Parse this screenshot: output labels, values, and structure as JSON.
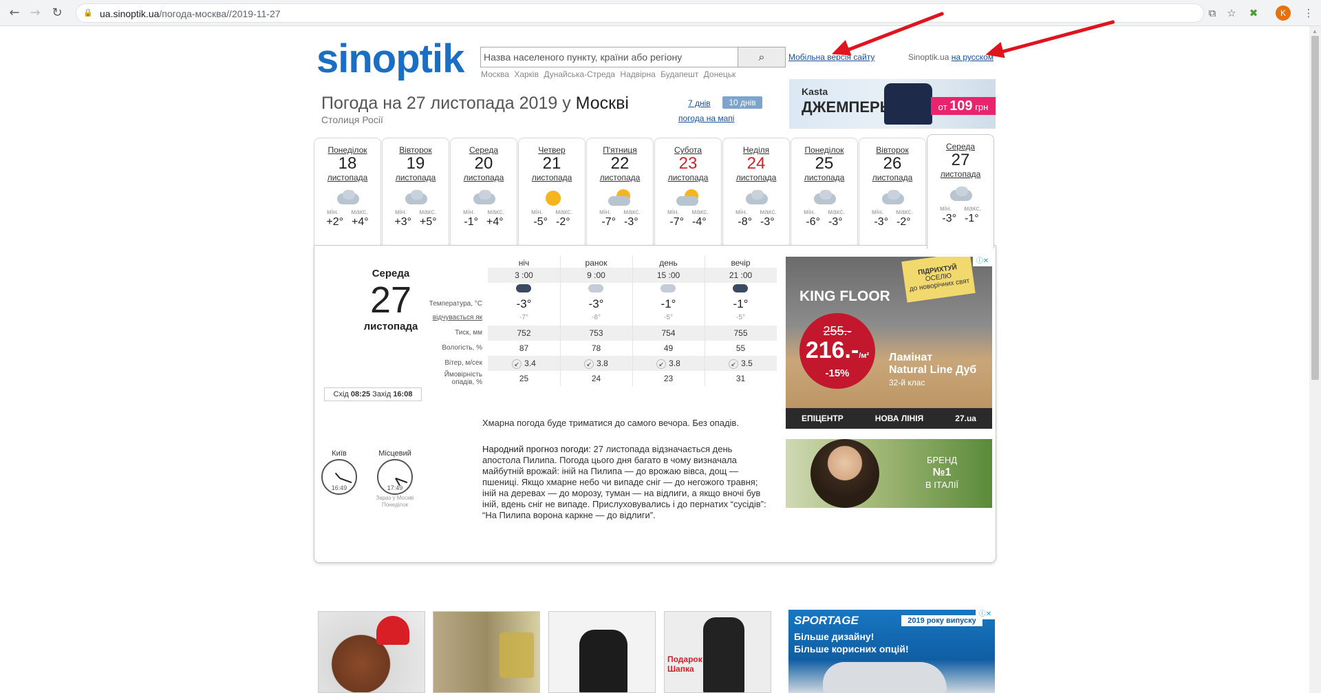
{
  "browser": {
    "url_host": "ua.sinoptik.ua",
    "url_path": "/погода-москва//2019-11-27",
    "profile_initial": "K"
  },
  "header": {
    "logo": "sinoptik",
    "search_placeholder": "Назва населеного пункту, країни або регіону",
    "quick_cities": [
      "Москва",
      "Харків",
      "Дунайська-Стреда",
      "Надвірна",
      "Будапешт",
      "Донецьк"
    ],
    "mobile_link": "Мобільна версія сайту",
    "ru_prefix": "Sinoptik.ua",
    "ru_link": "на русском"
  },
  "title": {
    "main": "Погода на 27 листопада 2019",
    "prep": "у",
    "city": "Москві",
    "subtitle": "Столиця Росії",
    "days7": "7 днів",
    "days10": "10 днів",
    "map": "погода на мапі"
  },
  "top_banner": {
    "brand": "Kasta",
    "product": "ДЖЕМПЕРЫ",
    "price_prefix": "от",
    "price": "109",
    "currency": "грн"
  },
  "days": [
    {
      "name": "Понеділок",
      "num": "18",
      "month": "листопада",
      "min": "+2°",
      "max": "+4°",
      "icon": "cloud-icon",
      "red": false
    },
    {
      "name": "Вівторок",
      "num": "19",
      "month": "листопада",
      "min": "+3°",
      "max": "+5°",
      "icon": "cloud-icon",
      "red": false
    },
    {
      "name": "Середа",
      "num": "20",
      "month": "листопада",
      "min": "-1°",
      "max": "+4°",
      "icon": "cloud-icon",
      "red": false
    },
    {
      "name": "Четвер",
      "num": "21",
      "month": "листопада",
      "min": "-5°",
      "max": "-2°",
      "icon": "sun-icon",
      "red": false
    },
    {
      "name": "П'ятниця",
      "num": "22",
      "month": "листопада",
      "min": "-7°",
      "max": "-3°",
      "icon": "sun-cloud-icon",
      "red": false
    },
    {
      "name": "Субота",
      "num": "23",
      "month": "листопада",
      "min": "-7°",
      "max": "-4°",
      "icon": "sun-cloud-icon",
      "red": true
    },
    {
      "name": "Неділя",
      "num": "24",
      "month": "листопада",
      "min": "-8°",
      "max": "-3°",
      "icon": "cloud-icon",
      "red": true
    },
    {
      "name": "Понеділок",
      "num": "25",
      "month": "листопада",
      "min": "-6°",
      "max": "-3°",
      "icon": "cloud-icon",
      "red": false
    },
    {
      "name": "Вівторок",
      "num": "26",
      "month": "листопада",
      "min": "-3°",
      "max": "-2°",
      "icon": "cloud-icon",
      "red": false
    },
    {
      "name": "Середа",
      "num": "27",
      "month": "листопада",
      "min": "-3°",
      "max": "-1°",
      "icon": "cloud-icon",
      "red": false
    }
  ],
  "labels": {
    "min": "мін.",
    "max": "макс."
  },
  "detail": {
    "day_name": "Середа",
    "day_num": "27",
    "month": "листопада",
    "sunrise_label": "Схід",
    "sunrise": "08:25",
    "sunset_label": "Захід",
    "sunset": "16:08",
    "periods": [
      "ніч",
      "ранок",
      "день",
      "вечір"
    ],
    "hours": [
      "3 :00",
      "9 :00",
      "15 :00",
      "21 :00"
    ],
    "row_labels": {
      "temp": "Температура, °C",
      "feels": "відчувається як",
      "pressure": "Тиск, мм",
      "humidity": "Вологість, %",
      "wind": "Вітер, м/сек",
      "precip_1": "Ймовірність",
      "precip_2": "опадів, %"
    },
    "temp": [
      "-3°",
      "-3°",
      "-1°",
      "-1°"
    ],
    "feels": [
      "-7°",
      "-8°",
      "-5°",
      "-5°"
    ],
    "pressure": [
      "752",
      "753",
      "754",
      "755"
    ],
    "humidity": [
      "87",
      "78",
      "49",
      "55"
    ],
    "wind_dir": "↙",
    "wind": [
      "3.4",
      "3.8",
      "3.8",
      "3.5"
    ],
    "precip": [
      "25",
      "24",
      "23",
      "31"
    ],
    "description": "Хмарна погода буде триматися до самого вечора. Без опадів.",
    "folk_title": "Народний прогноз погоди:",
    "folk_text": "27 листопада відзначається день апостола Пилипа. Погода цього дня багато в чому визначала майбутній врожай: іній на Пилипа — до врожаю вівса, дощ — пшениці. Якщо хмарне небо чи випаде сніг — до негожого травня; іній на деревах — до морозу, туман — на відлиги, а якщо вночі був іній, вдень сніг не випаде. Прислуховувались і до пернатих “сусідів”: “На Пилипа ворона каркне — до відлиги”.",
    "clock_kyiv_label": "Київ",
    "clock_kyiv_time": "16:49",
    "clock_local_label": "Місцевий",
    "clock_local_time": "17:49",
    "clock_note_1": "Зараз у Москві",
    "clock_note_2": "Понеділок"
  },
  "ads": {
    "kingfloor": {
      "brand": "KING FLOOR",
      "tag_1": "ПІДРИХТУЙ",
      "tag_2": "ОСЕЛЮ",
      "tag_3": "до новорічних свят",
      "old_price": "255.-",
      "new_price": "216.-",
      "unit": "/м²",
      "discount": "-15%",
      "product_1": "Ламінат",
      "product_2": "Natural Line Дуб",
      "class": "32-й клас",
      "footer": [
        "ЕПІЦЕНТР",
        "НОВА ЛІНІЯ",
        "27.ua"
      ]
    },
    "brand_ad": {
      "line1": "БРЕНД",
      "line2": "№1",
      "line3": "В ІТАЛІЇ"
    },
    "sportage": {
      "logo": "SPORTAGE",
      "year": "2019 року випуску",
      "line1": "Більше дизайну!",
      "line2": "Більше корисних опцій!"
    },
    "gift": {
      "line1": "Подарок",
      "line2": "Шапка"
    }
  }
}
